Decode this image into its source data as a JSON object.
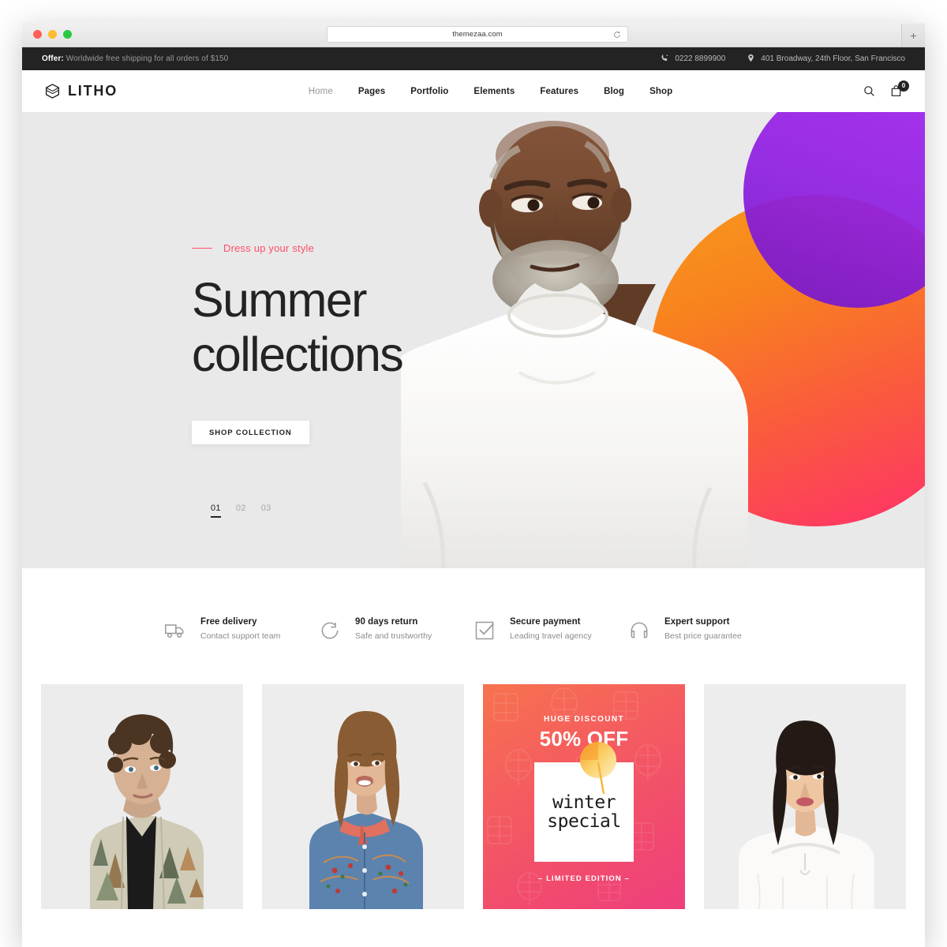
{
  "browser": {
    "url": "themezaa.com",
    "reload_icon": "reload-icon",
    "newtab_label": "+",
    "traffic_lights": [
      "close",
      "minimize",
      "maximize"
    ]
  },
  "topbar": {
    "offer_label": "Offer:",
    "offer_text": " Worldwide free shipping for all orders of $150",
    "phone": "0222 8899900",
    "address": "401 Broadway, 24th Floor, San Francisco",
    "phone_icon": "phone-icon",
    "location_icon": "map-pin-icon",
    "bg": "#232323"
  },
  "header": {
    "logo_text": "LITHO",
    "logo_icon": "cube-logo-icon",
    "nav": [
      {
        "label": "Home",
        "active": true
      },
      {
        "label": "Pages",
        "active": false
      },
      {
        "label": "Portfolio",
        "active": false
      },
      {
        "label": "Elements",
        "active": false
      },
      {
        "label": "Features",
        "active": false
      },
      {
        "label": "Blog",
        "active": false
      },
      {
        "label": "Shop",
        "active": false
      }
    ],
    "search_icon": "search-icon",
    "cart_icon": "shopping-bag-icon",
    "cart_count": "0"
  },
  "hero": {
    "eyebrow": "Dress up your style",
    "eyebrow_color": "#FF4E6A",
    "title_line1": "Summer",
    "title_line2": "collections",
    "cta_label": "SHOP COLLECTION",
    "background": "#e9e9e9",
    "slides": [
      {
        "label": "01",
        "active": true
      },
      {
        "label": "02",
        "active": false
      },
      {
        "label": "03",
        "active": false
      }
    ],
    "shapes": {
      "orange_gradient_from": "#F79A1C",
      "orange_gradient_to": "#FF2E6E",
      "purple_gradient_from": "#A626F0",
      "purple_gradient_to": "#7117C9"
    },
    "photo_alt": "Older man with grey beard wearing a white crewneck sweatshirt"
  },
  "features": [
    {
      "icon": "truck-icon",
      "title": "Free delivery",
      "subtitle": "Contact support team"
    },
    {
      "icon": "refresh-icon",
      "title": "90 days return",
      "subtitle": "Safe and trustworthy"
    },
    {
      "icon": "check-box-icon",
      "title": "Secure payment",
      "subtitle": "Leading travel agency"
    },
    {
      "icon": "headphone-icon",
      "title": "Expert support",
      "subtitle": "Best price guarantee"
    }
  ],
  "products": [
    {
      "type": "photo",
      "alt": "Young man in forest-print shirt over black tee"
    },
    {
      "type": "photo",
      "alt": "Girl in embroidered denim jacket with pink scarf"
    },
    {
      "type": "promo",
      "huge_discount": "HUGE DISCOUNT",
      "percent_off": "50% OFF",
      "word_line1": "winter",
      "word_line2": "special",
      "limited": "– LIMITED EDITION –",
      "gradient_from": "#F7734E",
      "gradient_to": "#EE3F7E",
      "lollipop_icon": "lollipop-icon"
    },
    {
      "type": "photo",
      "alt": "Woman in white off-shoulder blouse"
    }
  ]
}
